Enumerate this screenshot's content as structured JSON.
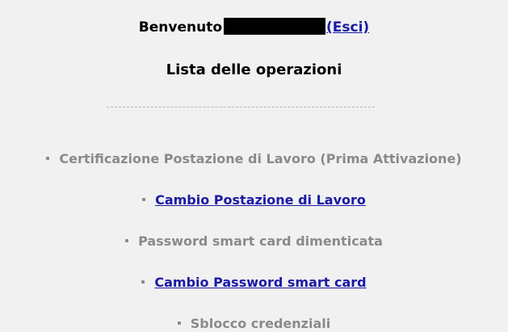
{
  "header": {
    "welcome_label": "Benvenuto",
    "logout_link": "(Esci)"
  },
  "page_title": "Lista delle operazioni",
  "operations": [
    {
      "label": "Certificazione Postazione di Lavoro (Prima Attivazione)",
      "link": false
    },
    {
      "label": "Cambio Postazione di Lavoro",
      "link": true
    },
    {
      "label": "Password smart card dimenticata",
      "link": false
    },
    {
      "label": "Cambio Password smart card",
      "link": true
    },
    {
      "label": "Sblocco credenziali",
      "link": false
    }
  ],
  "colors": {
    "link": "#1a1aa6",
    "disabled_text": "#8a8a8a",
    "background": "#f1f1f1"
  }
}
